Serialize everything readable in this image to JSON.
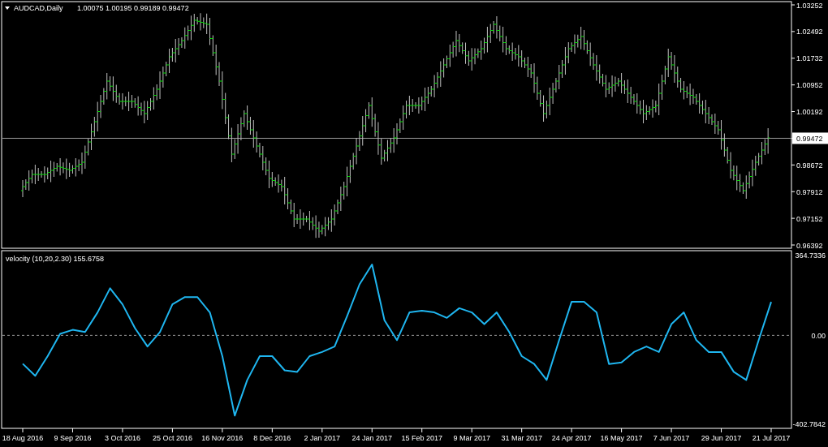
{
  "price_pane": {
    "symbol": "AUDCAD,Daily",
    "ohlc": "1.00075 1.00195 0.99189 0.99472",
    "price_axis": [
      {
        "label": "1.03252",
        "kind": "tick"
      },
      {
        "label": "1.02492",
        "kind": "tick"
      },
      {
        "label": "1.01732",
        "kind": "tick"
      },
      {
        "label": "1.00952",
        "kind": "tick"
      },
      {
        "label": "1.00192",
        "kind": "tick"
      },
      {
        "label": "0.99472",
        "kind": "current"
      },
      {
        "label": "0.98672",
        "kind": "tick"
      },
      {
        "label": "0.97912",
        "kind": "tick"
      },
      {
        "label": "0.97152",
        "kind": "tick"
      },
      {
        "label": "0.96392",
        "kind": "tick"
      }
    ]
  },
  "indicator_pane": {
    "params": "(10,20,2.30) 155.6758",
    "chart_data": {
      "type": "line",
      "ylim": [
        -425.03,
        386.98
      ],
      "yticks": [
        {
          "value": 364.7336,
          "label": "364.7336"
        },
        {
          "value": 0,
          "label": "0.00"
        },
        {
          "value": -402.7842,
          "label": "-402.7842"
        }
      ],
      "categories": [
        "18 Aug 2016",
        null,
        null,
        null,
        "9 Sep 2016",
        null,
        null,
        null,
        "3 Oct 2016",
        null,
        null,
        null,
        "25 Oct 2016",
        null,
        null,
        null,
        "16 Nov 2016",
        null,
        null,
        null,
        "8 Dec 2016",
        null,
        null,
        null,
        "2 Jan 2017",
        null,
        null,
        null,
        "24 Jan 2017",
        null,
        null,
        null,
        "15 Feb 2017",
        null,
        null,
        null,
        "9 Mar 2017",
        null,
        null,
        null,
        "31 Mar 2017",
        null,
        null,
        null,
        "24 Apr 2017",
        null,
        null,
        null,
        "16 May 2017",
        null,
        null,
        null,
        "7 Jun 2017",
        null,
        null,
        null,
        "29 Jun 2017",
        null,
        null,
        null,
        "21 Jul 2017"
      ],
      "series": [
        {
          "name": "velocity",
          "color": "#1fb6f0",
          "values": [
            -130,
            -185,
            -95,
            7,
            25,
            15,
            105,
            215,
            142,
            33,
            -51,
            15,
            142,
            175,
            175,
            105,
            -95,
            -367,
            -204,
            -95,
            -95,
            -160,
            -167,
            -95,
            -76,
            -51,
            87,
            233,
            324,
            69,
            -22,
            105,
            113,
            105,
            80,
            124,
            105,
            51,
            105,
            15,
            -95,
            -131,
            -204,
            -22,
            153,
            153,
            105,
            -131,
            -124,
            -76,
            -51,
            -76,
            51,
            105,
            -22,
            -76,
            -76,
            -167,
            -204,
            -22,
            153
          ]
        }
      ]
    }
  }
}
